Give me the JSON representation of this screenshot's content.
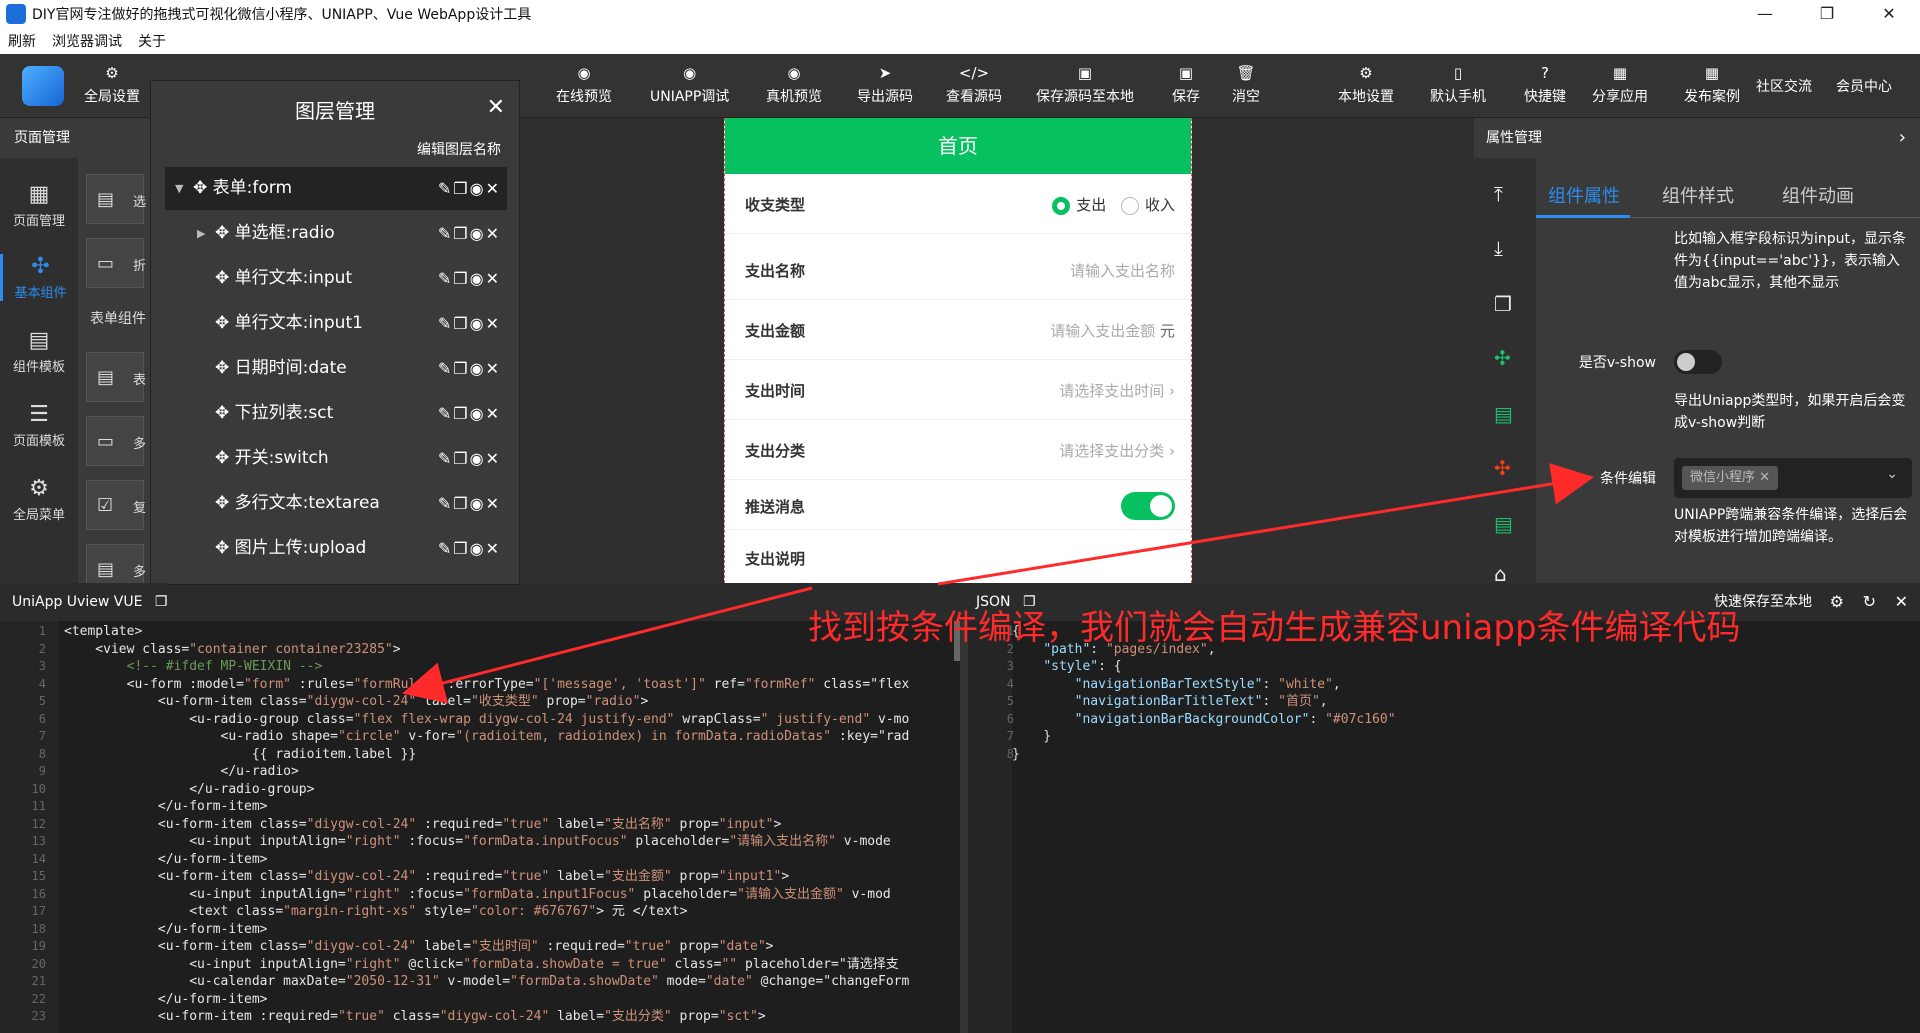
{
  "window": {
    "title": "DIY官网专注做好的拖拽式可视化微信小程序、UNIAPP、Vue WebApp设计工具",
    "controls": [
      "—",
      "❐",
      "✕"
    ]
  },
  "menubar": [
    "刷新",
    "浏览器调试",
    "关于"
  ],
  "toolbar": [
    {
      "label": "全局设置",
      "icon": "cog-icon"
    },
    {
      "label": "在线预览",
      "icon": "eye-icon"
    },
    {
      "label": "UNIAPP调试",
      "icon": "eye-icon"
    },
    {
      "label": "真机预览",
      "icon": "eye-icon"
    },
    {
      "label": "导出源码",
      "icon": "send-icon"
    },
    {
      "label": "查看源码",
      "icon": "code-icon"
    },
    {
      "label": "保存源码至本地",
      "icon": "save-icon"
    },
    {
      "label": "保存",
      "icon": "save-icon"
    },
    {
      "label": "消空",
      "icon": "trash-icon"
    },
    {
      "label": "本地设置",
      "icon": "gear-icon"
    },
    {
      "label": "默认手机",
      "icon": "phone-icon"
    },
    {
      "label": "快捷键",
      "icon": "help-icon"
    },
    {
      "label": "分享应用",
      "icon": "share-icon"
    },
    {
      "label": "发布案例",
      "icon": "publish-icon"
    },
    {
      "label": "社区交流",
      "icon": ""
    },
    {
      "label": "会员中心",
      "icon": ""
    }
  ],
  "left": {
    "header": "页面管理",
    "rail": [
      {
        "label": "页面管理",
        "icon": "grid-icon"
      },
      {
        "label": "基本组件",
        "icon": "puzzle-icon"
      },
      {
        "label": "组件模板",
        "icon": "template-icon"
      },
      {
        "label": "页面模板",
        "icon": "database-icon"
      },
      {
        "label": "全局菜单",
        "icon": "gear-icon"
      }
    ],
    "list_section": "表单组件",
    "list_items": [
      "选",
      "折",
      "表",
      "多",
      "复",
      "多"
    ]
  },
  "layer_panel": {
    "title": "图层管理",
    "subtitle": "编辑图层名称",
    "rows": [
      {
        "name": "表单:form",
        "toggle": "▼"
      },
      {
        "name": "单选框:radio",
        "toggle": "▶"
      },
      {
        "name": "单行文本:input",
        "toggle": ""
      },
      {
        "name": "单行文本:input1",
        "toggle": ""
      },
      {
        "name": "日期时间:date",
        "toggle": ""
      },
      {
        "name": "下拉列表:sct",
        "toggle": ""
      },
      {
        "name": "开关:switch",
        "toggle": ""
      },
      {
        "name": "多行文本:textarea",
        "toggle": ""
      },
      {
        "name": "图片上传:upload",
        "toggle": ""
      }
    ]
  },
  "phone": {
    "title": "首页",
    "fields": {
      "type_label": "收支类型",
      "radio_out": "支出",
      "radio_in": "收入",
      "name_label": "支出名称",
      "name_placeholder": "请输入支出名称",
      "amount_label": "支出金额",
      "amount_placeholder": "请输入支出金额",
      "amount_unit": "元",
      "time_label": "支出时间",
      "time_placeholder": "请选择支出时间",
      "category_label": "支出分类",
      "category_placeholder": "请选择支出分类",
      "push_label": "推送消息",
      "desc_label": "支出说明"
    }
  },
  "right_panel": {
    "header": "属性管理",
    "tabs": [
      "组件属性",
      "组件样式",
      "组件动画"
    ],
    "desc1": "比如输入框字段标识为input，显示条件为{{input=='abc'}}，表示输入值为abc显示，其他不显示",
    "vshow_label": "是否v-show",
    "desc2": "导出Uniapp类型时，如果开启后会变成v-show判断",
    "cond_label": "条件编辑",
    "cond_tag": "微信小程序",
    "desc3": "UNIAPP跨端兼容条件编译，选择后会对模板进行增加跨端编译。"
  },
  "editor_left": {
    "title": "UniApp Uview VUE",
    "lines": [
      "<template>",
      "    <view class=\"container container23285\">",
      "        <!-- #ifdef MP-WEIXIN -->",
      "        <u-form :model=\"form\" :rules=\"formRules\" :errorType=\"['message', 'toast']\" ref=\"formRef\" class=\"flex",
      "            <u-form-item class=\"diygw-col-24\" label=\"收支类型\" prop=\"radio\">",
      "                <u-radio-group class=\"flex flex-wrap diygw-col-24 justify-end\" wrapClass=\" justify-end\" v-mo",
      "                    <u-radio shape=\"circle\" v-for=\"(radioitem, radioindex) in formData.radioDatas\" :key=\"rad",
      "                        {{ radioitem.label }}",
      "                    </u-radio>",
      "                </u-radio-group>",
      "            </u-form-item>",
      "            <u-form-item class=\"diygw-col-24\" :required=\"true\" label=\"支出名称\" prop=\"input\">",
      "                <u-input inputAlign=\"right\" :focus=\"formData.inputFocus\" placeholder=\"请输入支出名称\" v-mode",
      "            </u-form-item>",
      "            <u-form-item class=\"diygw-col-24\" :required=\"true\" label=\"支出金额\" prop=\"input1\">",
      "                <u-input inputAlign=\"right\" :focus=\"formData.input1Focus\" placeholder=\"请输入支出金额\" v-mod",
      "                <text class=\"margin-right-xs\" style=\"color: #676767\"> 元 </text>",
      "            </u-form-item>",
      "            <u-form-item class=\"diygw-col-24\" label=\"支出时间\" :required=\"true\" prop=\"date\">",
      "                <u-input inputAlign=\"right\" @click=\"formData.showDate = true\" class=\"\" placeholder=\"请选择支",
      "                <u-calendar maxDate=\"2050-12-31\" v-model=\"formData.showDate\" mode=\"date\" @change=\"changeForm",
      "            </u-form-item>",
      "            <u-form-item :required=\"true\" class=\"diygw-col-24\" label=\"支出分类\" prop=\"sct\">"
    ]
  },
  "editor_right": {
    "title": "JSON",
    "save_label": "快速保存至本地",
    "lines": [
      "{",
      "    \"path\": \"pages/index\",",
      "    \"style\": {",
      "        \"navigationBarTextStyle\": \"white\",",
      "        \"navigationBarTitleText\": \"首页\",",
      "        \"navigationBarBackgroundColor\": \"#07c160\"",
      "    }",
      "}"
    ]
  },
  "annotation": "找到按条件编译，我们就会自动生成兼容uniapp条件编译代码",
  "colors": {
    "accent": "#2d8cf0",
    "brand_green": "#07c160",
    "annotation_red": "#ff2a2a"
  }
}
